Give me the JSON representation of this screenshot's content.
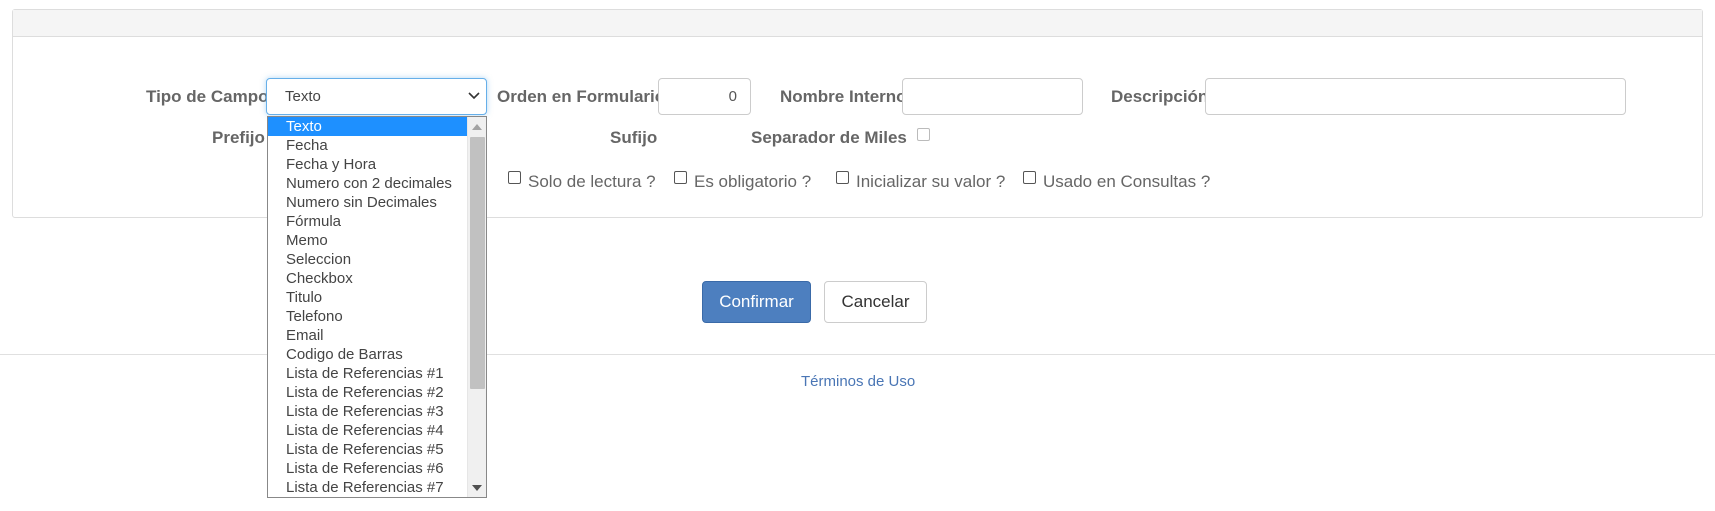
{
  "form": {
    "tipo_label": "Tipo de Campo",
    "tipo_value": "Texto",
    "orden_label": "Orden en Formulario",
    "orden_value": "0",
    "nombre_label": "Nombre Interno",
    "nombre_value": "",
    "descripcion_label": "Descripción",
    "descripcion_value": "",
    "prefijo_label": "Prefijo",
    "sufijo_label": "Sufijo",
    "separador_label": "Separador de Miles",
    "checkboxes": [
      {
        "label": "Solo de lectura ?",
        "checked": false
      },
      {
        "label": "Es obligatorio ?",
        "checked": false
      },
      {
        "label": "Inicializar su valor ?",
        "checked": false
      },
      {
        "label": "Usado en Consultas ?",
        "checked": false
      }
    ]
  },
  "buttons": {
    "confirm": "Confirmar",
    "cancel": "Cancelar"
  },
  "footer": {
    "terms": "Términos de Uso"
  },
  "dropdown": {
    "selected": "Texto",
    "options": [
      "Texto",
      "Fecha",
      "Fecha y Hora",
      "Numero con 2 decimales",
      "Numero sin Decimales",
      "Fórmula",
      "Memo",
      "Seleccion",
      "Checkbox",
      "Titulo",
      "Telefono",
      "Email",
      "Codigo de Barras",
      "Lista de Referencias #1",
      "Lista de Referencias #2",
      "Lista de Referencias #3",
      "Lista de Referencias #4",
      "Lista de Referencias #5",
      "Lista de Referencias #6",
      "Lista de Referencias #7"
    ]
  },
  "colors": {
    "primary": "#4d7fbf",
    "link": "#4a76b5",
    "selected_option": "#1e90ff",
    "focus_border": "#66afe9"
  }
}
